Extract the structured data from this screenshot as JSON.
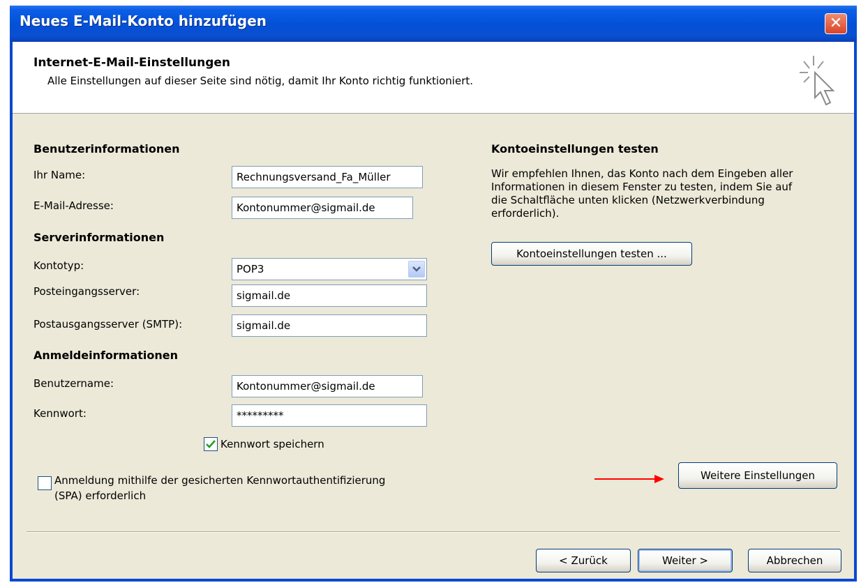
{
  "window": {
    "title": "Neues E-Mail-Konto hinzufügen",
    "close_label": "✕"
  },
  "header": {
    "title": "Internet-E-Mail-Einstellungen",
    "subtitle": "Alle Einstellungen auf dieser Seite sind nötig, damit Ihr Konto richtig funktioniert."
  },
  "user_info": {
    "heading": "Benutzerinformationen",
    "name_label": "Ihr Name:",
    "name_value": "Rechnungsversand_Fa_Müller",
    "email_label": "E-Mail-Adresse:",
    "email_value": "Kontonummer@sigmail.de"
  },
  "server_info": {
    "heading": "Serverinformationen",
    "account_type_label": "Kontotyp:",
    "account_type_value": "POP3",
    "incoming_label": "Posteingangsserver:",
    "incoming_value": "sigmail.de",
    "outgoing_label": "Postausgangsserver (SMTP):",
    "outgoing_value": "sigmail.de"
  },
  "login_info": {
    "heading": "Anmeldeinformationen",
    "username_label": "Benutzername:",
    "username_value": "Kontonummer@sigmail.de",
    "password_label": "Kennwort:",
    "password_value": "*********",
    "remember_label": "Kennwort speichern",
    "remember_checked": true,
    "spa_label_line1": "Anmeldung mithilfe der gesicherten Kennwortauthentifizierung",
    "spa_label_line2": "(SPA) erforderlich",
    "spa_checked": false
  },
  "test": {
    "heading": "Kontoeinstellungen testen",
    "description": "Wir empfehlen Ihnen, das Konto nach dem Eingeben aller Informationen in diesem Fenster zu testen, indem Sie auf die Schaltfläche unten klicken (Netzwerkverbindung erforderlich).",
    "button": "Kontoeinstellungen testen ..."
  },
  "more_settings_button": "Weitere Einstellungen",
  "footer": {
    "back": "< Zurück",
    "next": "Weiter >",
    "cancel": "Abbrechen"
  },
  "colors": {
    "titlebar": "#0451d8",
    "client": "#ece9d8",
    "annotation_arrow": "#ff0000"
  }
}
